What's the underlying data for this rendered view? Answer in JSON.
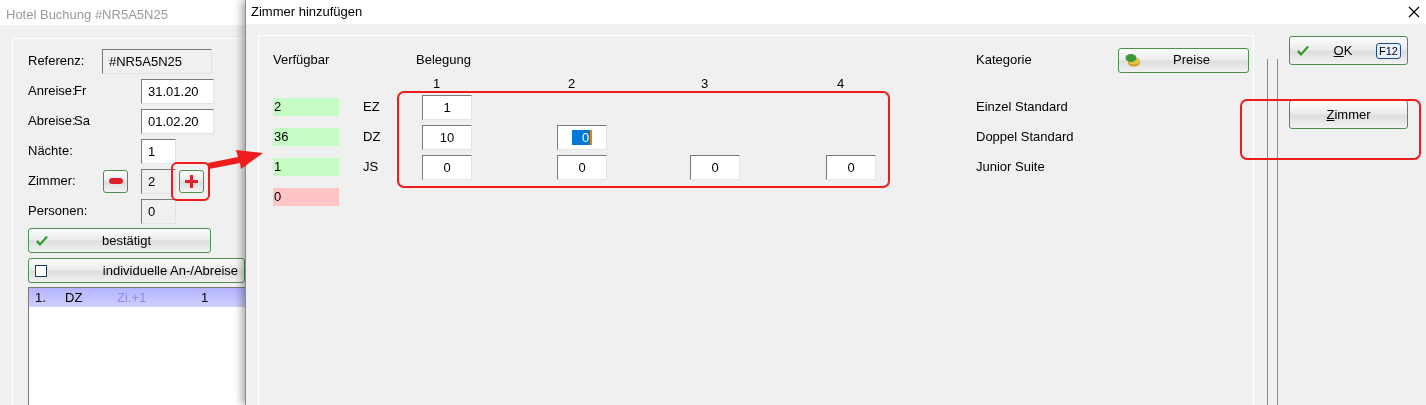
{
  "back_window": {
    "title": "Hotel Buchung #NR5A5N25",
    "fields": [
      {
        "kind": "text",
        "label": "Referenz:",
        "value": "#NR5A5N25",
        "readonly": true
      },
      {
        "kind": "date",
        "label": "Anreise:",
        "day": "Fr",
        "value": "31.01.20",
        "readonly": false
      },
      {
        "kind": "date",
        "label": "Abreise:",
        "day": "Sa",
        "value": "01.02.20",
        "readonly": false
      },
      {
        "kind": "number",
        "label": "Nächte:",
        "value": "1",
        "readonly": false
      },
      {
        "kind": "stepper",
        "label": "Zimmer:",
        "value": "2",
        "readonly": true
      },
      {
        "kind": "number",
        "label": "Personen:",
        "value": "0",
        "readonly": true
      }
    ],
    "confirm_button": {
      "label": "bestätigt"
    },
    "individual_toggle": {
      "label": "individuelle An-/Abreise",
      "checked": false
    },
    "rows": [
      {
        "number": "1.",
        "category": "DZ",
        "note": "Zi.+1",
        "persons": "1",
        "selected": true
      }
    ]
  },
  "dialog": {
    "title": "Zimmer hinzufügen",
    "available_heading": "Verfügbar",
    "occupancy_heading": "Belegung",
    "column_numbers": [
      "1",
      "2",
      "3",
      "4"
    ],
    "category_heading": "Kategorie",
    "prices_button": {
      "label": "Preise"
    },
    "rows": [
      {
        "available": "2",
        "color": "#c4fcc4",
        "code": "EZ",
        "counts": [
          {
            "value": "1",
            "selected": false
          }
        ],
        "category": "Einzel Standard"
      },
      {
        "available": "36",
        "color": "#c4fcc4",
        "code": "DZ",
        "counts": [
          {
            "value": "10",
            "selected": false
          },
          {
            "value": "0",
            "selected": true
          }
        ],
        "category": "Doppel Standard"
      },
      {
        "available": "1",
        "color": "#c4fcc4",
        "code": "JS",
        "counts": [
          {
            "value": "0",
            "selected": false
          },
          {
            "value": "0",
            "selected": false
          },
          {
            "value": "0",
            "selected": false
          },
          {
            "value": "0",
            "selected": false
          }
        ],
        "category": "Junior Suite"
      },
      {
        "available": "0",
        "color": "#ffc4c4"
      }
    ],
    "ok_button": {
      "label": "OK",
      "shortcut": "F12"
    },
    "rooms_button": {
      "label": "Zimmer"
    }
  }
}
